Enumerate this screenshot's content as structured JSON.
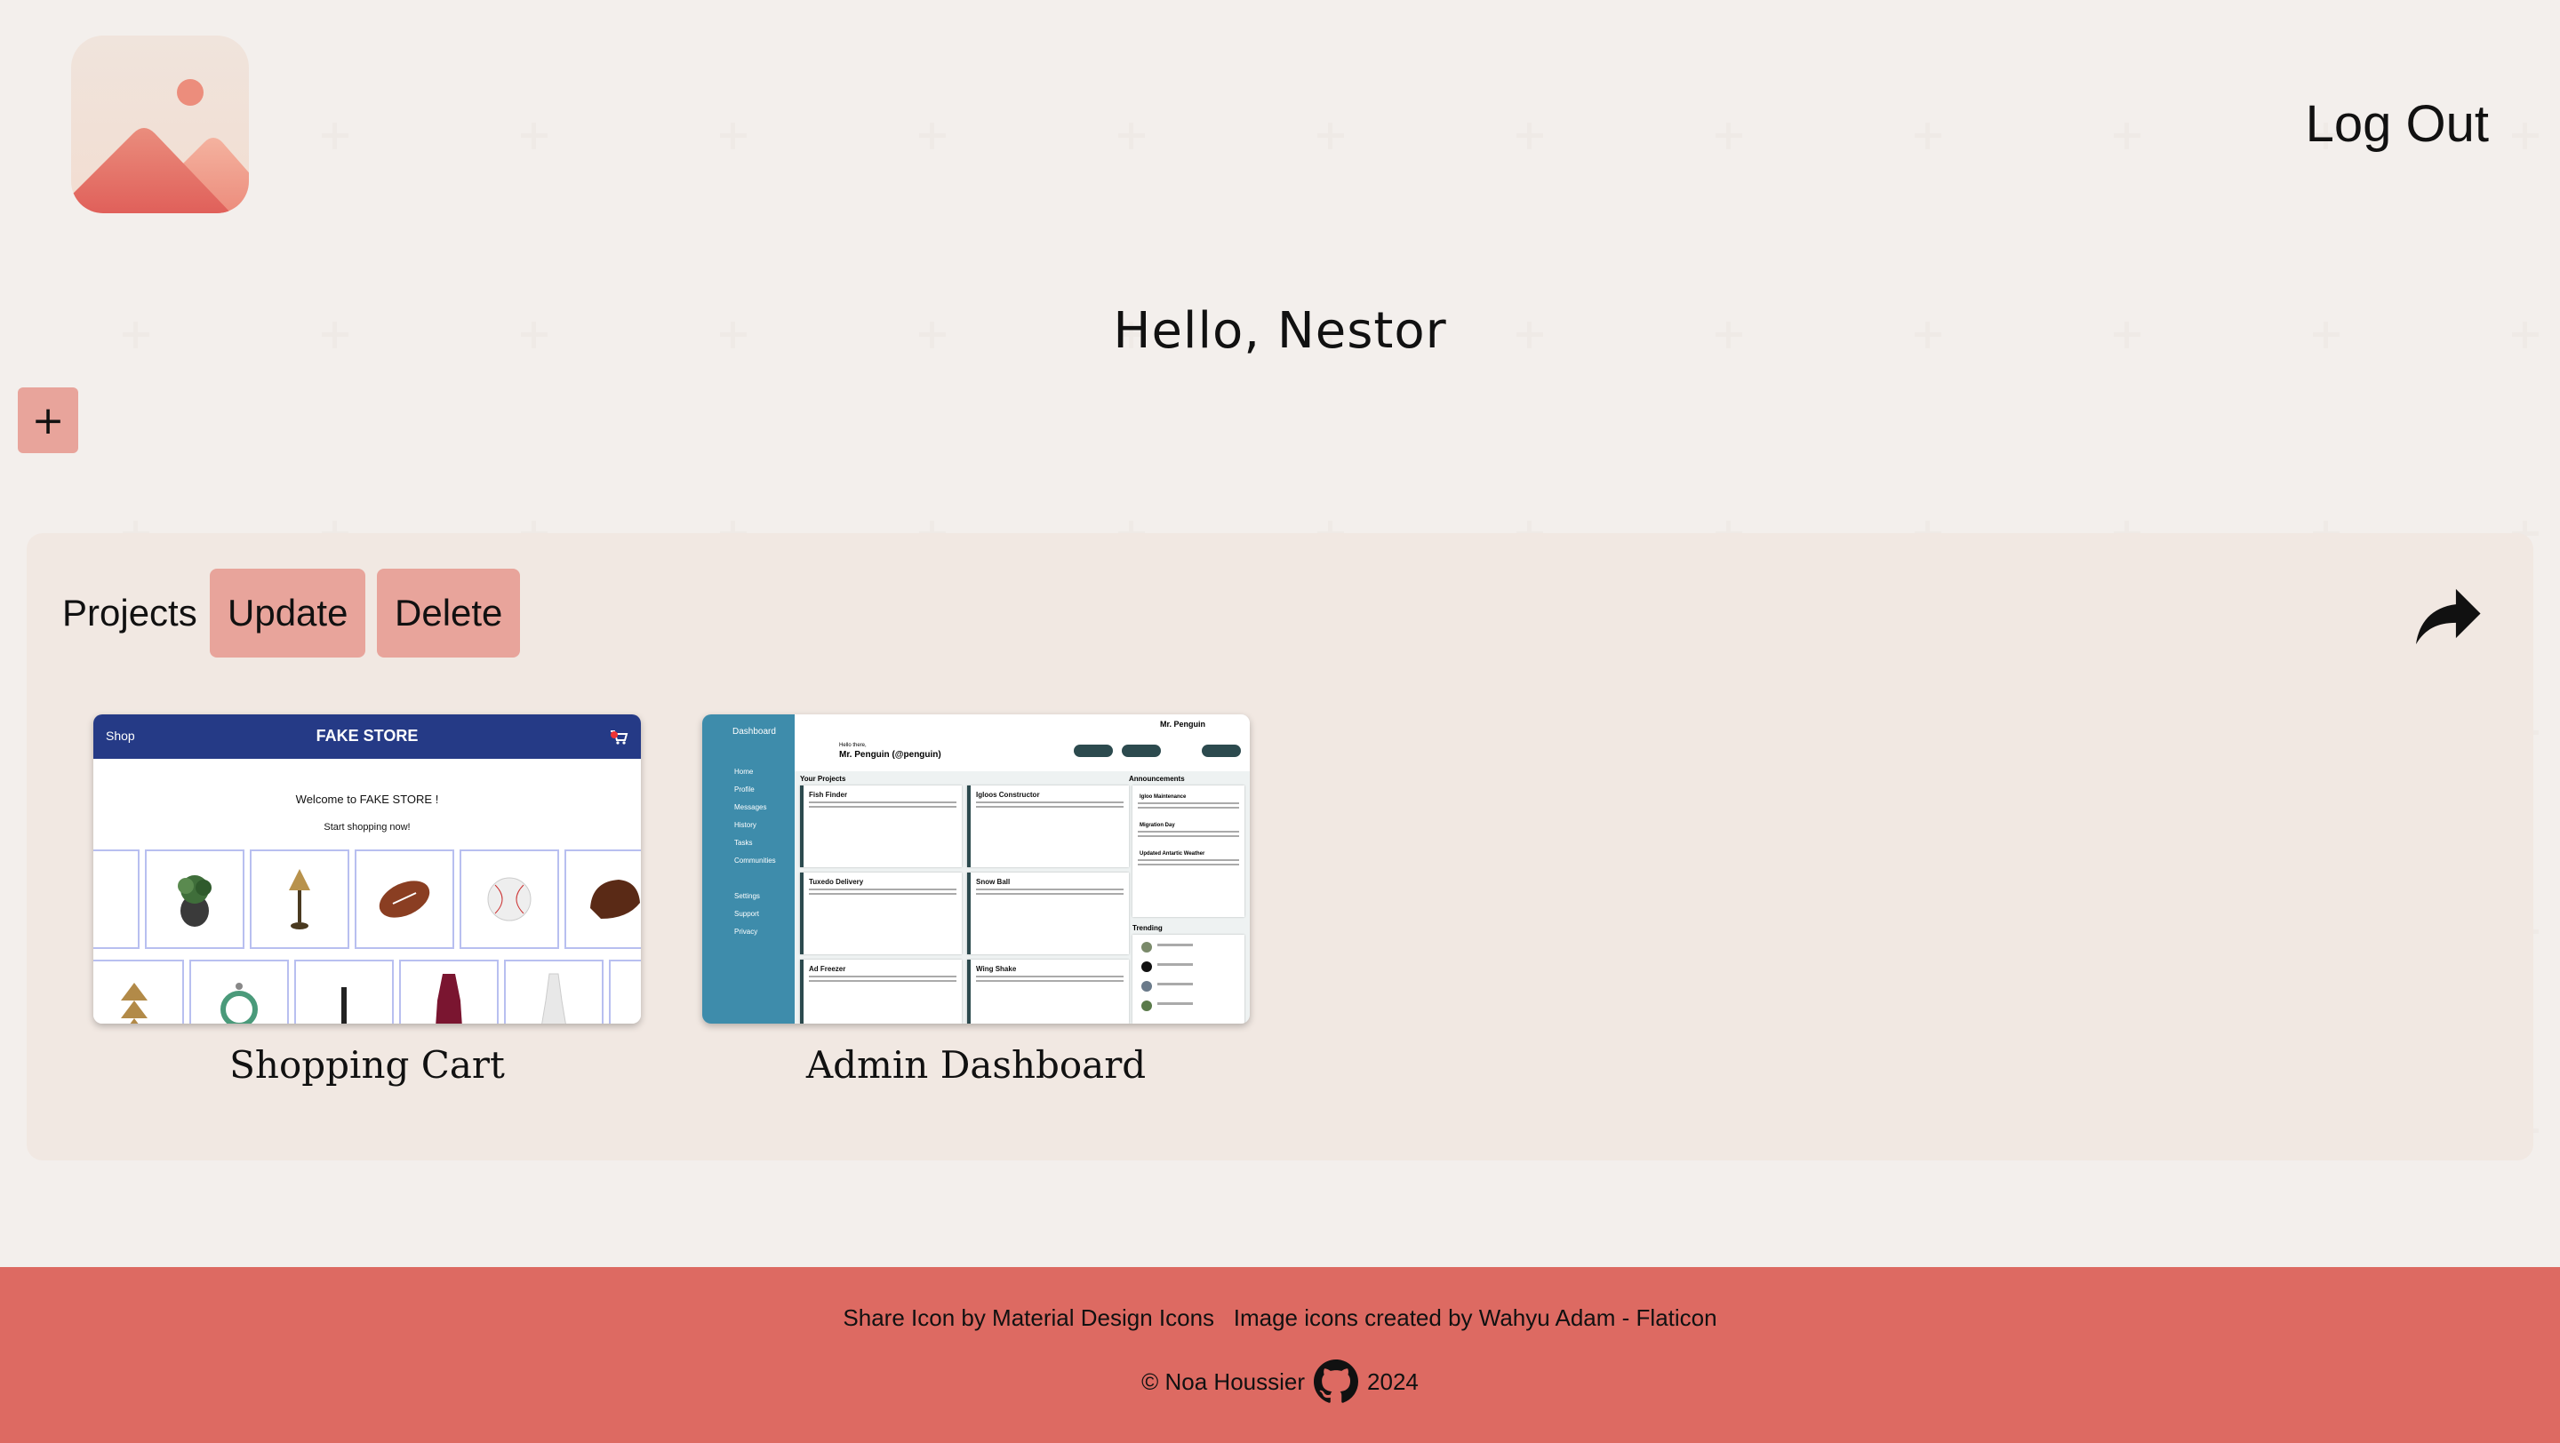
{
  "header": {
    "logout_label": "Log Out"
  },
  "greeting": "Hello, Nestor",
  "add_button": "+",
  "projects_panel": {
    "title": "Projects",
    "update_label": "Update",
    "delete_label": "Delete",
    "cards": [
      {
        "label": "Shopping Cart"
      },
      {
        "label": "Admin Dashboard"
      }
    ]
  },
  "store_thumb": {
    "shop": "Shop",
    "brand": "FAKE STORE",
    "welcome": "Welcome to FAKE STORE !",
    "start": "Start shopping now!"
  },
  "dash_thumb": {
    "side_title": "Dashboard",
    "nav": [
      "Home",
      "Profile",
      "Messages",
      "History",
      "Tasks",
      "Communities",
      "Settings",
      "Support",
      "Privacy"
    ],
    "hello": "Hello there,",
    "user": "Mr. Penguin (@penguin)",
    "user_short": "Mr. Penguin",
    "your_projects": "Your Projects",
    "announcements": "Announcements",
    "trending": "Trending",
    "projects": [
      "Fish Finder",
      "Igloos Constructor",
      "Tuxedo Delivery",
      "Snow Ball",
      "Ad Freezer",
      "Wing Shake"
    ],
    "ann": [
      "Igloo Maintenance",
      "Migration Day",
      "Updated Antartic Weather"
    ]
  },
  "footer": {
    "credits": "Share Icon by Material Design Icons   Image icons created by Wahyu Adam - Flaticon",
    "copy_left": "© Noa Houssier",
    "copy_right": "2024"
  },
  "colors": {
    "accent_pink": "#e8a49b",
    "panel_bg": "#f1e8e2",
    "footer_bg": "#dd6a62"
  }
}
